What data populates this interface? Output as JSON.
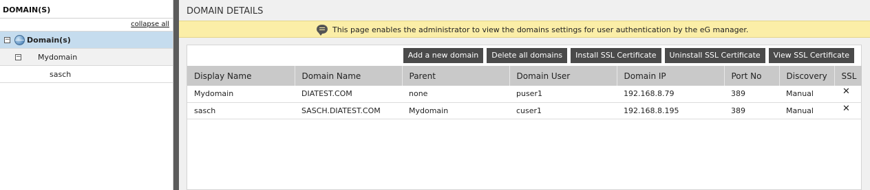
{
  "left_panel": {
    "title": "DOMAIN(S)",
    "collapse_all": "collapse all",
    "tree": [
      {
        "label": "Domain(s)",
        "expander": "−"
      },
      {
        "label": "Mydomain",
        "expander": "−"
      },
      {
        "label": "sasch"
      }
    ]
  },
  "main": {
    "title": "DOMAIN DETAILS",
    "info_message": "This page enables the administrator to view the domains settings for user authentication by the eG manager.",
    "buttons": {
      "add": "Add a new domain",
      "delete_all": "Delete all domains",
      "install_ssl": "Install SSL Certificate",
      "uninstall_ssl": "Uninstall SSL Certificate",
      "view_ssl": "View SSL Certificate"
    },
    "table": {
      "columns": [
        "Display Name",
        "Domain Name",
        "Parent",
        "Domain User",
        "Domain IP",
        "Port No",
        "Discovery",
        "SSL"
      ],
      "rows": [
        {
          "display_name": "Mydomain",
          "domain_name": "DIATEST.COM",
          "parent": "none",
          "domain_user": "puser1",
          "domain_ip": "192.168.8.79",
          "port": "389",
          "discovery": "Manual",
          "ssl": "✕"
        },
        {
          "display_name": "sasch",
          "domain_name": "SASCH.DIATEST.COM",
          "parent": "Mydomain",
          "domain_user": "cuser1",
          "domain_ip": "192.168.8.195",
          "port": "389",
          "discovery": "Manual",
          "ssl": "✕"
        }
      ]
    }
  },
  "colors": {
    "selected_row": "#c5dcee",
    "info_bar": "#fbeea7",
    "button_bg": "#4a4a4a",
    "table_header": "#c9c9c9",
    "splitter": "#5b5b5b"
  },
  "icons": [
    "globe-icon",
    "comment-icon",
    "close-icon",
    "collapse-icon"
  ]
}
